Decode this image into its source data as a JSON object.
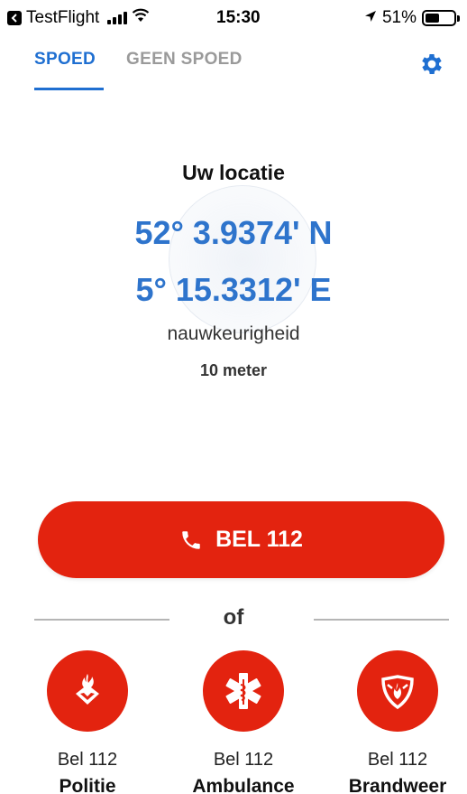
{
  "status_bar": {
    "back_app": "TestFlight",
    "time": "15:30",
    "battery": "51%",
    "battery_level": 0.51
  },
  "tabs": [
    {
      "label": "SPOED",
      "active": true
    },
    {
      "label": "GEEN SPOED",
      "active": false
    }
  ],
  "location": {
    "title": "Uw locatie",
    "latitude": "52° 3.9374' N",
    "longitude": "5° 15.3312' E",
    "accuracy_label": "nauwkeurigheid",
    "accuracy_value": "10 meter"
  },
  "call": {
    "label": "BEL 112"
  },
  "divider": {
    "text": "of"
  },
  "services": [
    {
      "line1": "Bel 112",
      "line2": "Politie",
      "icon": "police-icon"
    },
    {
      "line1": "Bel 112",
      "line2": "Ambulance",
      "icon": "star-of-life-icon"
    },
    {
      "line1": "Bel 112",
      "line2": "Brandweer",
      "icon": "fire-department-icon"
    }
  ],
  "colors": {
    "accent_blue": "#2e74cc",
    "tab_blue": "#1f6fd1",
    "emergency_red": "#e3230f",
    "inactive_gray": "#9a9a9a"
  }
}
